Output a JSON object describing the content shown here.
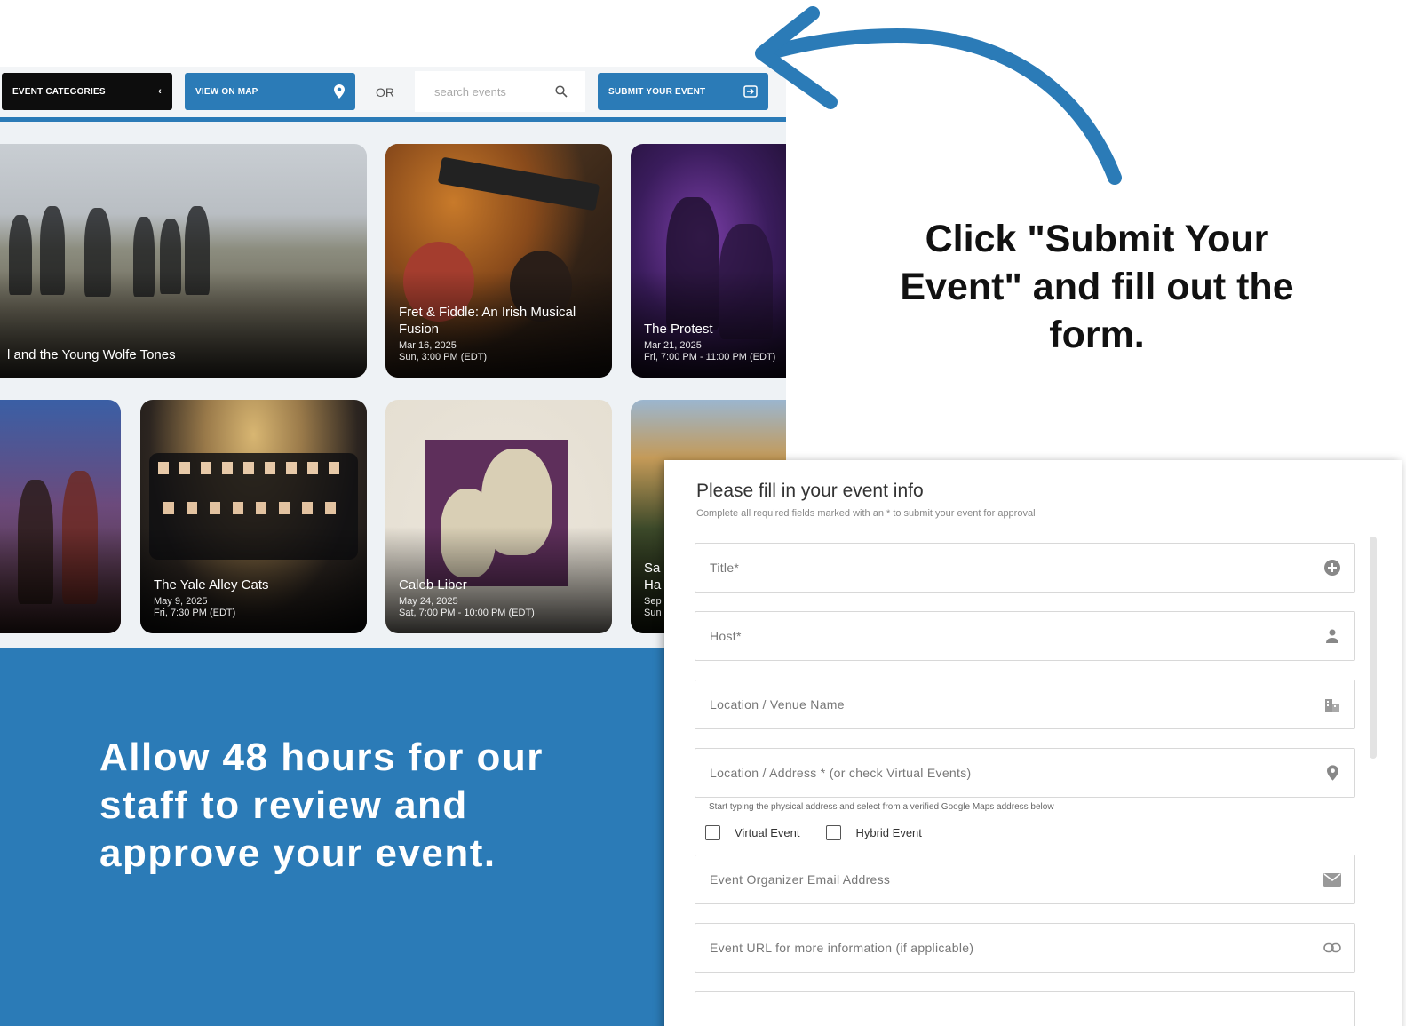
{
  "toolbar": {
    "categories_label": "EVENT CATEGORIES",
    "map_label": "VIEW ON MAP",
    "or_label": "OR",
    "search_placeholder": "search events",
    "submit_label": "SUBMIT YOUR EVENT"
  },
  "events": [
    {
      "title": "l and the Young Wolfe Tones",
      "date": "",
      "time": ""
    },
    {
      "title": "Fret & Fiddle: An Irish Musical Fusion",
      "date": "Mar 16, 2025",
      "time": "Sun, 3:00 PM (EDT)"
    },
    {
      "title": "The Protest",
      "date": "Mar 21, 2025",
      "time": "Fri, 7:00 PM - 11:00 PM (EDT)"
    },
    {
      "title": "",
      "date": "",
      "time": ""
    },
    {
      "title": "The Yale Alley Cats",
      "date": "May 9, 2025",
      "time": "Fri, 7:30 PM (EDT)"
    },
    {
      "title": "Caleb Liber",
      "date": "May 24, 2025",
      "time": "Sat, 7:00 PM - 10:00 PM (EDT)"
    },
    {
      "title": "Sa Ha",
      "date": "Sep",
      "time": "Sun"
    }
  ],
  "callouts": {
    "click_instruction": "Click \"Submit Your Event\" and fill out the form.",
    "review_note": "Allow 48 hours for our staff to review and approve your event."
  },
  "form": {
    "heading": "Please fill in your event info",
    "subheading": "Complete all required fields marked with an * to submit your event for approval",
    "fields": {
      "title": "Title*",
      "host": "Host*",
      "venue": "Location / Venue Name",
      "address": "Location / Address * (or check Virtual Events)",
      "email": "Event Organizer Email Address",
      "url": "Event URL for more information (if applicable)"
    },
    "address_hint": "Start typing the physical address and select from a verified Google Maps address below",
    "virtual_label": "Virtual Event",
    "hybrid_label": "Hybrid Event"
  },
  "colors": {
    "brand_blue": "#2b7bb7",
    "dark_button": "#0d0d0d"
  }
}
